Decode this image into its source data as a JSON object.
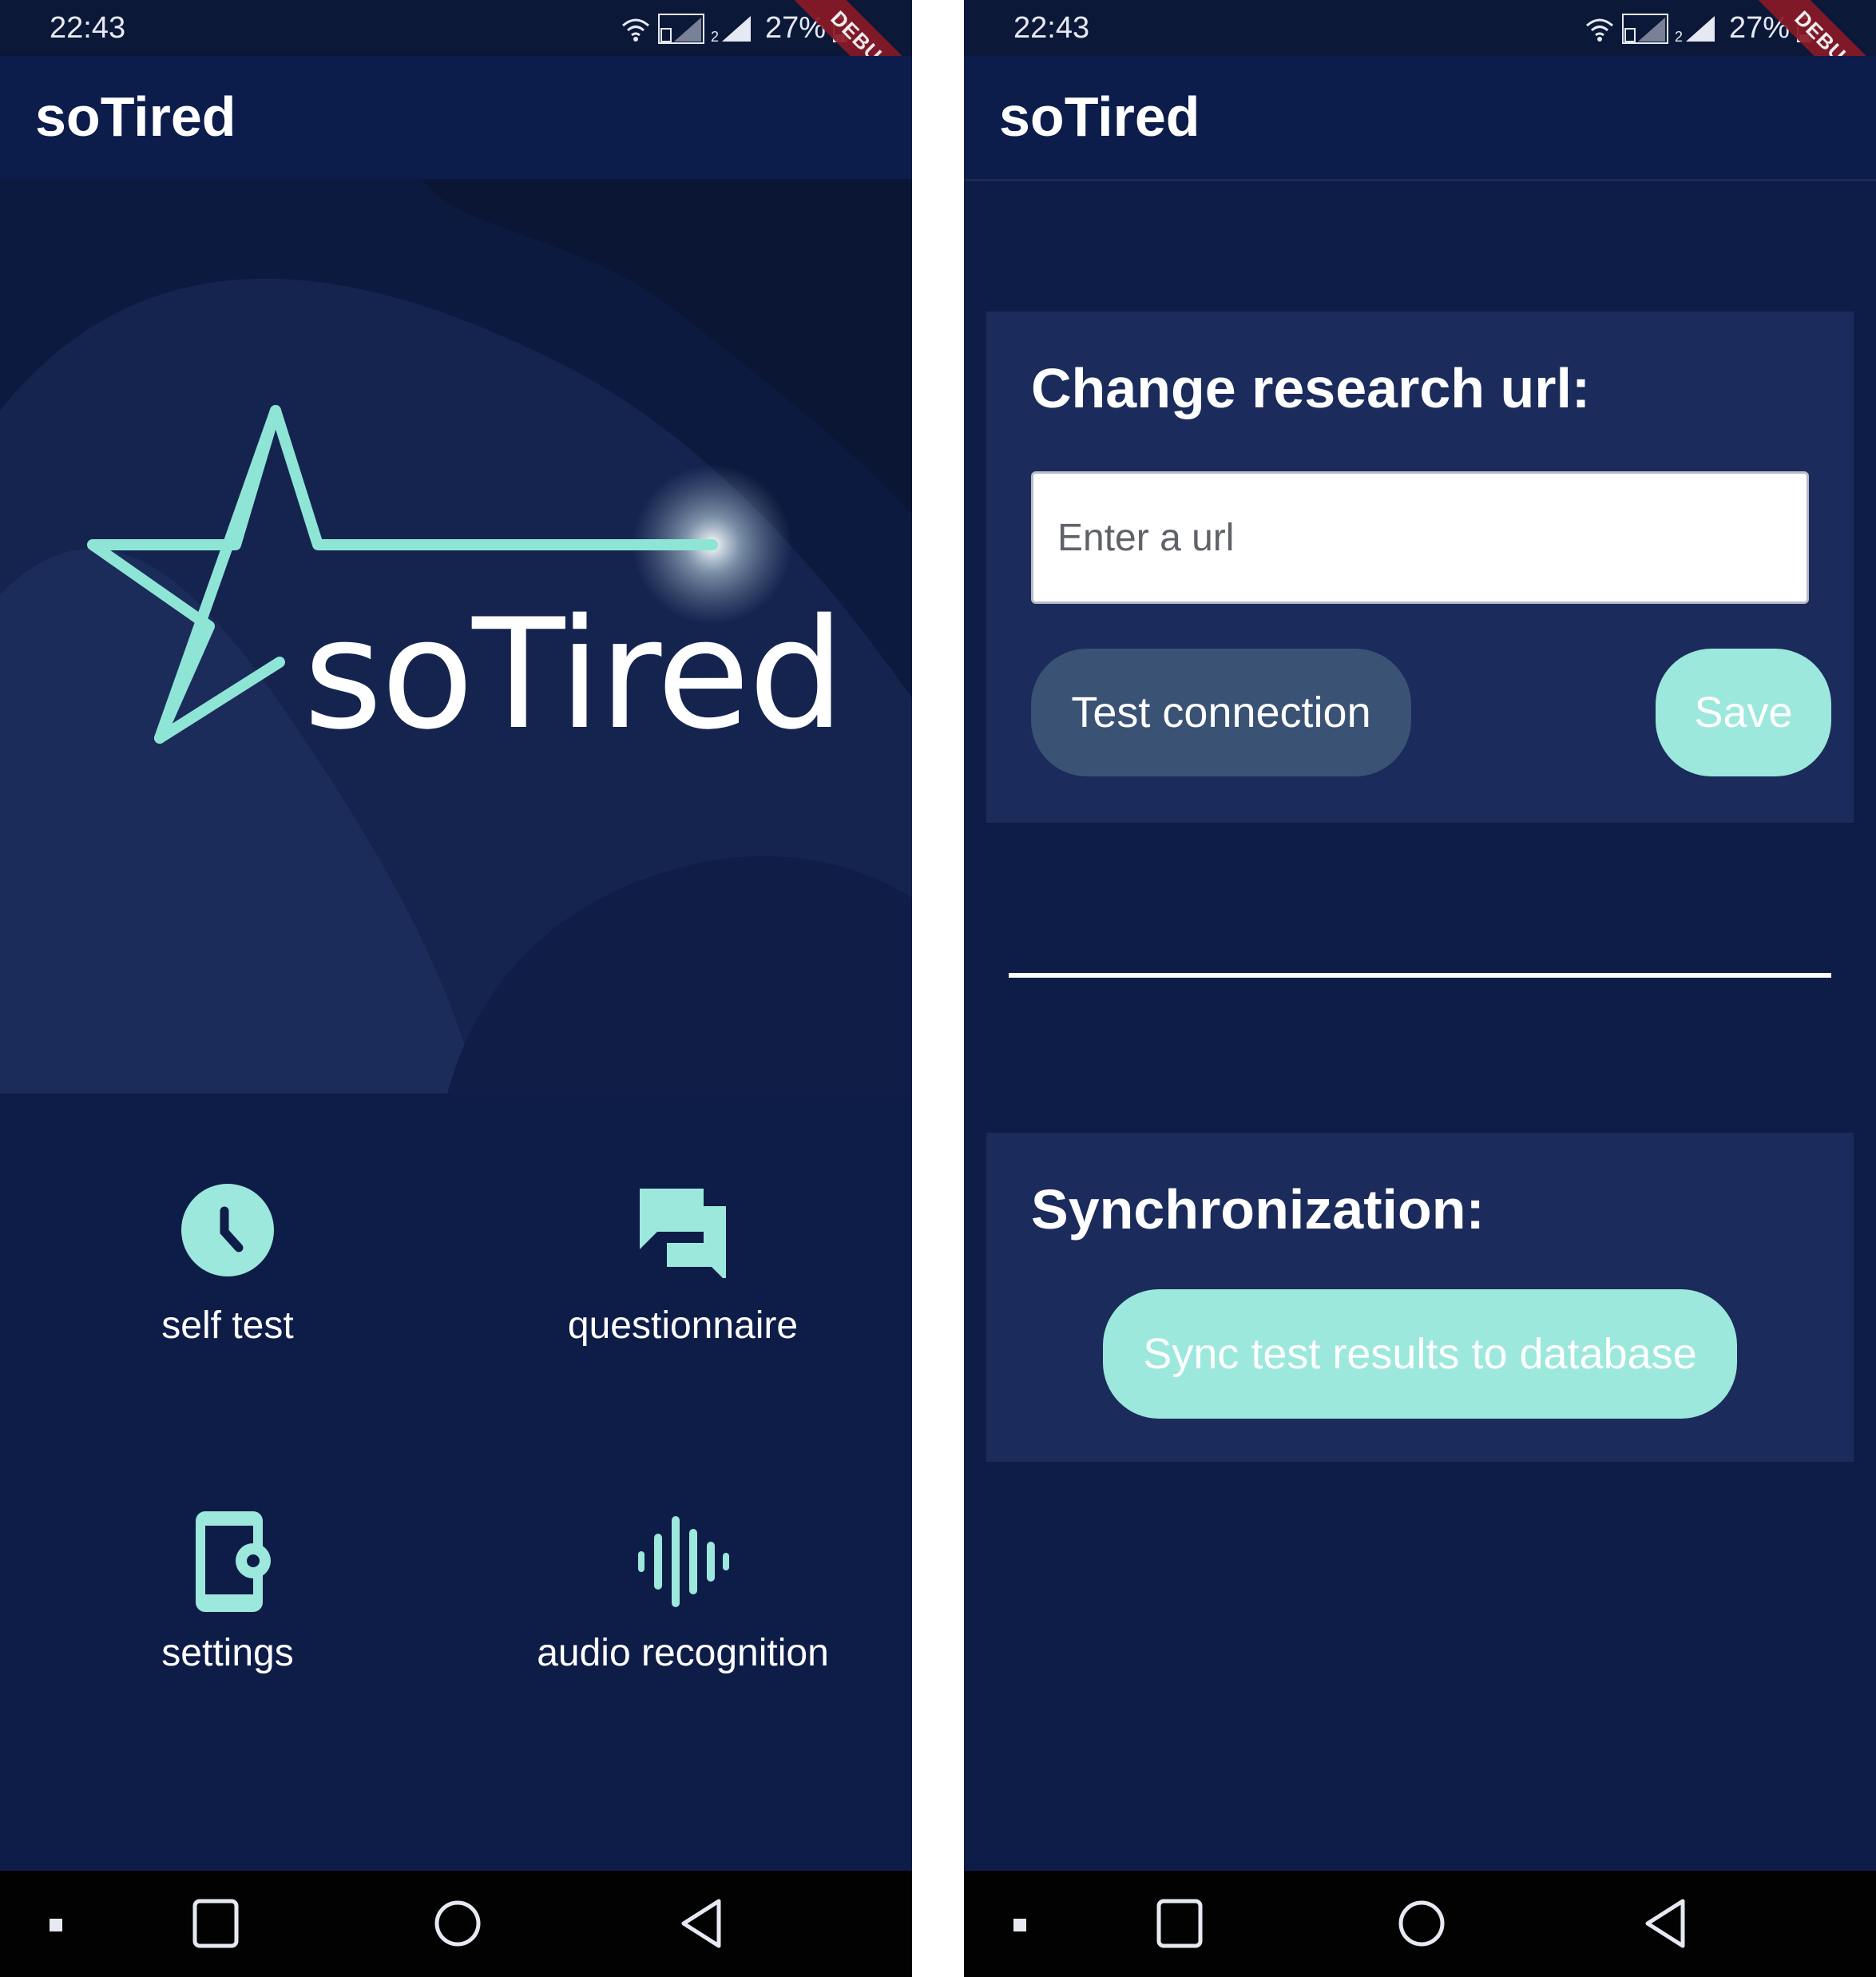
{
  "status_bar": {
    "time": "22:43",
    "battery": "27%",
    "debug_label": "DEBUG"
  },
  "home": {
    "app_title": "soTired",
    "logo_text": "soTired",
    "menu": [
      {
        "label": "self test",
        "icon": "clock-icon"
      },
      {
        "label": "questionnaire",
        "icon": "chat-bubbles-icon"
      },
      {
        "label": "settings",
        "icon": "phone-settings-icon"
      },
      {
        "label": "audio recognition",
        "icon": "audio-wave-icon"
      }
    ]
  },
  "settings": {
    "app_title": "soTired",
    "research_card": {
      "title": "Change research url:",
      "url_placeholder": "Enter a url",
      "test_button": "Test connection",
      "save_button": "Save"
    },
    "sync_card": {
      "title": "Synchronization:",
      "sync_button": "Sync test results to database"
    }
  },
  "colors": {
    "background": "#0e1c48",
    "appbar": "#0c1c4b",
    "card": "#1b2b5b",
    "accent": "#9ce8dc",
    "secondary_button": "#3a5273"
  }
}
